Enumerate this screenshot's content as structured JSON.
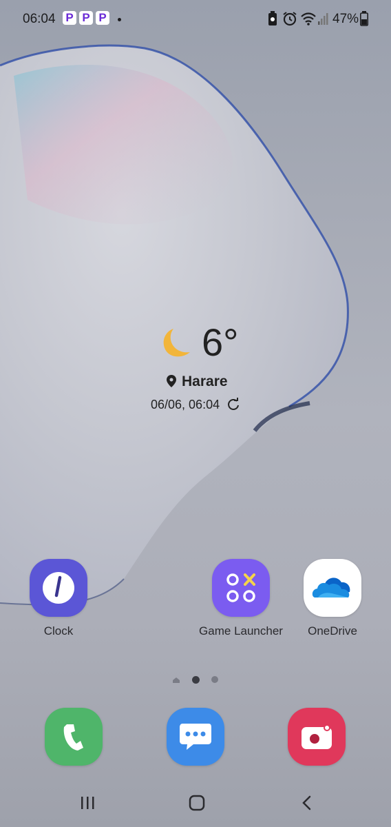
{
  "status_bar": {
    "time": "06:04",
    "notification_badges": [
      "P",
      "P",
      "P"
    ],
    "battery_percent": "47%",
    "icons": [
      "battery-saver-icon",
      "alarm-icon",
      "wifi-icon",
      "signal-icon",
      "battery-icon"
    ]
  },
  "weather_widget": {
    "temperature": "6°",
    "condition_icon": "moon-icon",
    "location": "Harare",
    "updated": "06/06, 06:04"
  },
  "home_apps": [
    {
      "label": "Clock",
      "icon": "clock-icon",
      "color": "#5b56d6"
    },
    {
      "label": "Game Launcher",
      "icon": "game-launcher-icon",
      "color": "#7b5cf0"
    },
    {
      "label": "OneDrive",
      "icon": "onedrive-icon",
      "color": "#ffffff"
    }
  ],
  "page_indicator": {
    "pages": 3,
    "current": 2
  },
  "dock": [
    {
      "icon": "phone-icon",
      "color": "#4fb56a"
    },
    {
      "icon": "messages-icon",
      "color": "#3d8be8"
    },
    {
      "icon": "camera-icon",
      "color": "#e0385b"
    }
  ],
  "nav_bar": [
    "recents-icon",
    "home-icon",
    "back-icon"
  ]
}
